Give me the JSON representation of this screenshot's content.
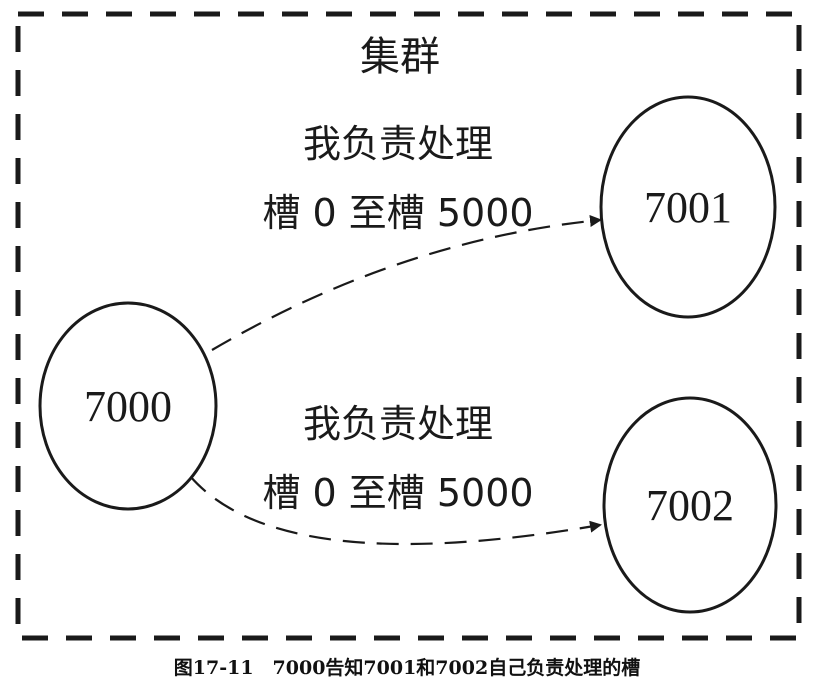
{
  "cluster": {
    "label": "集群"
  },
  "nodes": [
    {
      "id": "7000"
    },
    {
      "id": "7001"
    },
    {
      "id": "7002"
    }
  ],
  "messages": [
    {
      "from": "7000",
      "to": "7001",
      "line1": "我负责处理",
      "line2": "槽 0 至槽 5000"
    },
    {
      "from": "7000",
      "to": "7002",
      "line1": "我负责处理",
      "line2": "槽 0 至槽 5000"
    }
  ],
  "caption": "图17-11　7000告知7001和7002自己负责处理的槽"
}
